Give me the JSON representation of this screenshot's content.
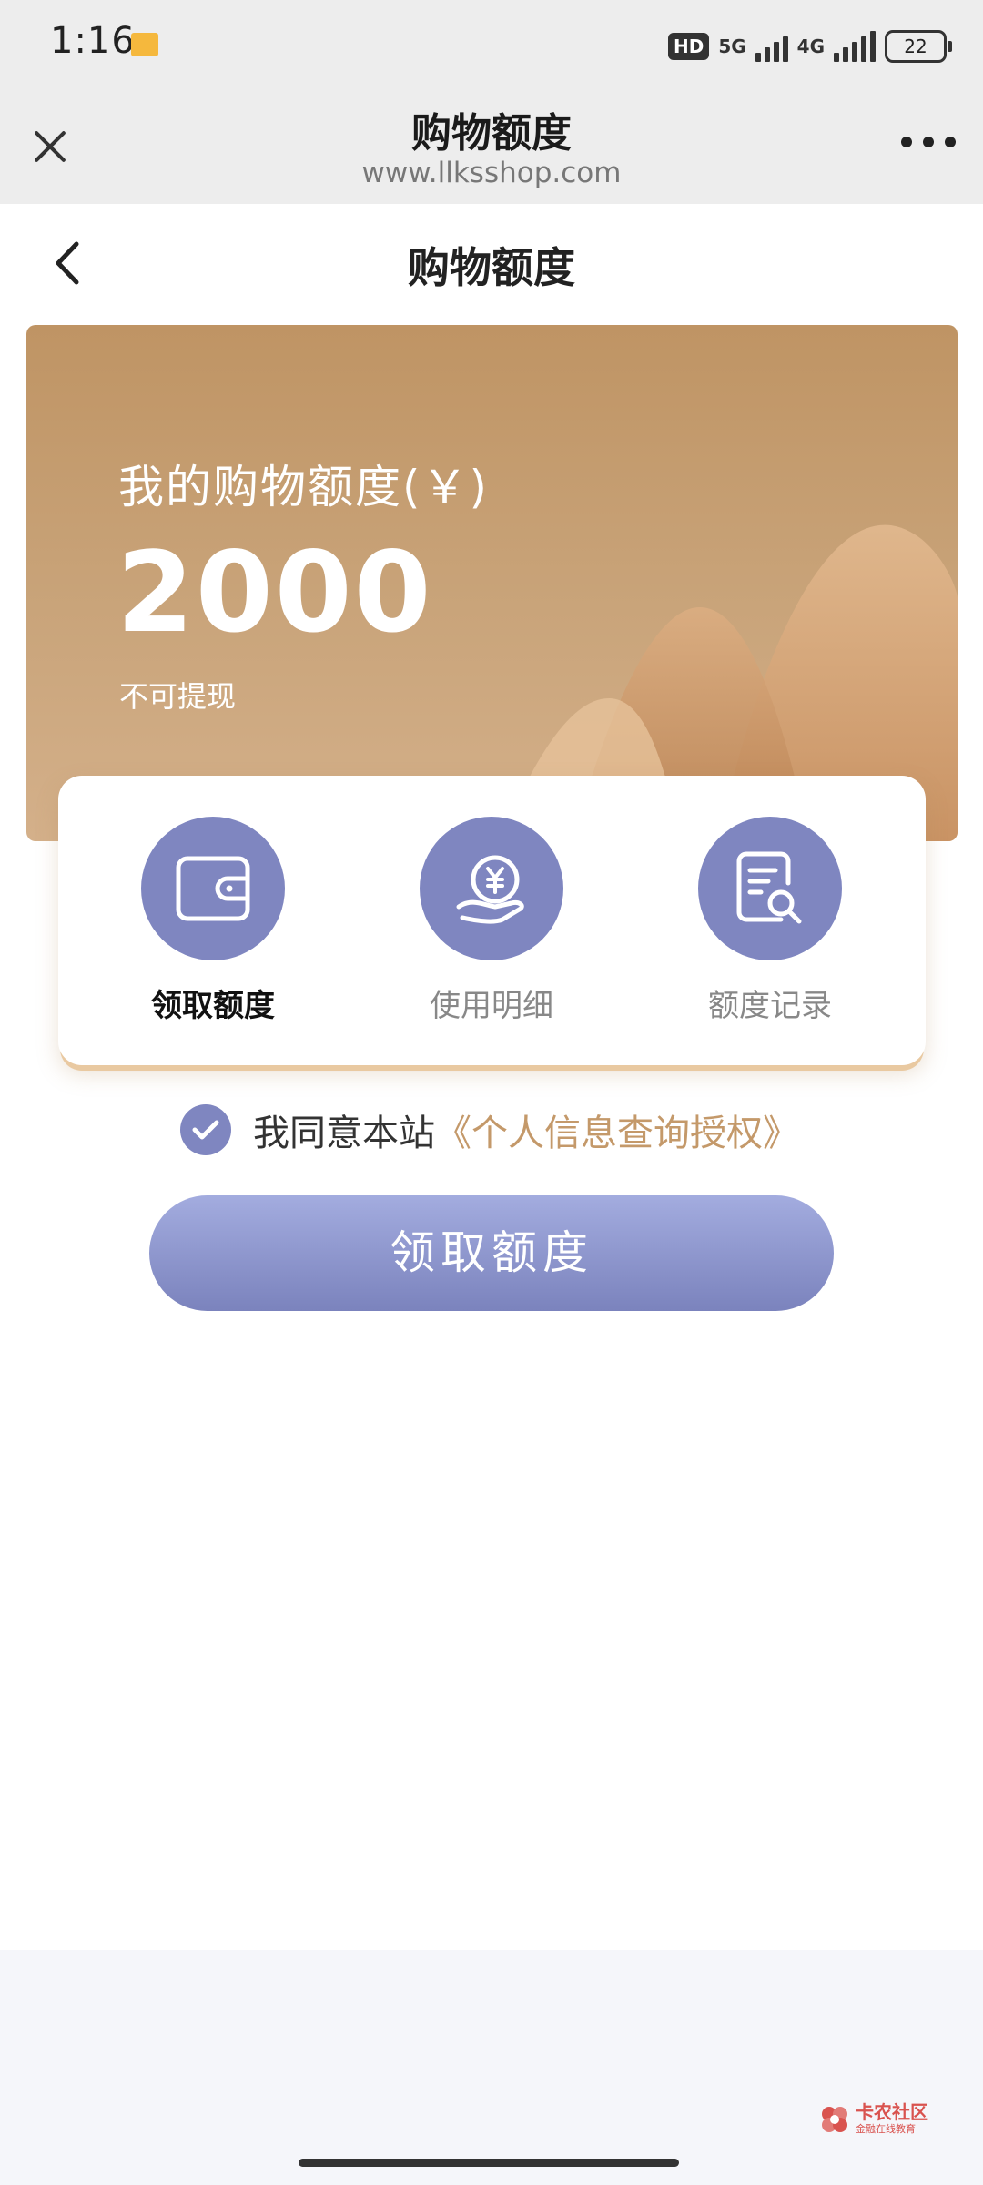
{
  "status_bar": {
    "time": "1:16",
    "hd": "HD",
    "net1": "5G",
    "net2": "4G",
    "battery": "22"
  },
  "browser": {
    "title": "购物额度",
    "url": "www.llksshop.com"
  },
  "page": {
    "title": "购物额度"
  },
  "hero": {
    "label": "我的购物额度(￥)",
    "amount": "2000",
    "note": "不可提现"
  },
  "actions": [
    {
      "label": "领取额度",
      "icon": "wallet-icon"
    },
    {
      "label": "使用明细",
      "icon": "coin-hand-icon"
    },
    {
      "label": "额度记录",
      "icon": "record-search-icon"
    }
  ],
  "agreement": {
    "checked": true,
    "text": "我同意本站",
    "link": "《个人信息查询授权》"
  },
  "cta": {
    "label": "领取额度"
  },
  "watermark": {
    "brand": "卡农社区",
    "sub": "金融在线教育"
  },
  "colors": {
    "accent": "#7f86c0",
    "hero_brown": "#c39a6c",
    "link_gold": "#c4996a"
  }
}
